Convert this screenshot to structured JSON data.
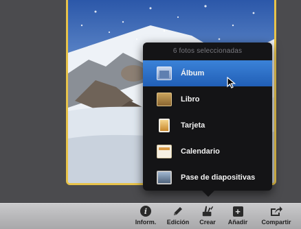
{
  "popover": {
    "header": "6 fotos seleccionadas",
    "items": [
      {
        "label": "Álbum",
        "icon": "album-icon",
        "selected": true
      },
      {
        "label": "Libro",
        "icon": "book-icon",
        "selected": false
      },
      {
        "label": "Tarjeta",
        "icon": "card-icon",
        "selected": false
      },
      {
        "label": "Calendario",
        "icon": "calendar-icon",
        "selected": false
      },
      {
        "label": "Pase de diapositivas",
        "icon": "slideshow-icon",
        "selected": false
      }
    ]
  },
  "toolbar": {
    "info_label": "Inform.",
    "edit_label": "Edición",
    "create_label": "Crear",
    "add_label": "Añadir",
    "share_label": "Compartir"
  },
  "colors": {
    "selection_frame": "#e8c34a",
    "menu_highlight": "#2e72c9",
    "menu_bg": "#141416",
    "toolbar_bg": "#bcbcbe"
  }
}
